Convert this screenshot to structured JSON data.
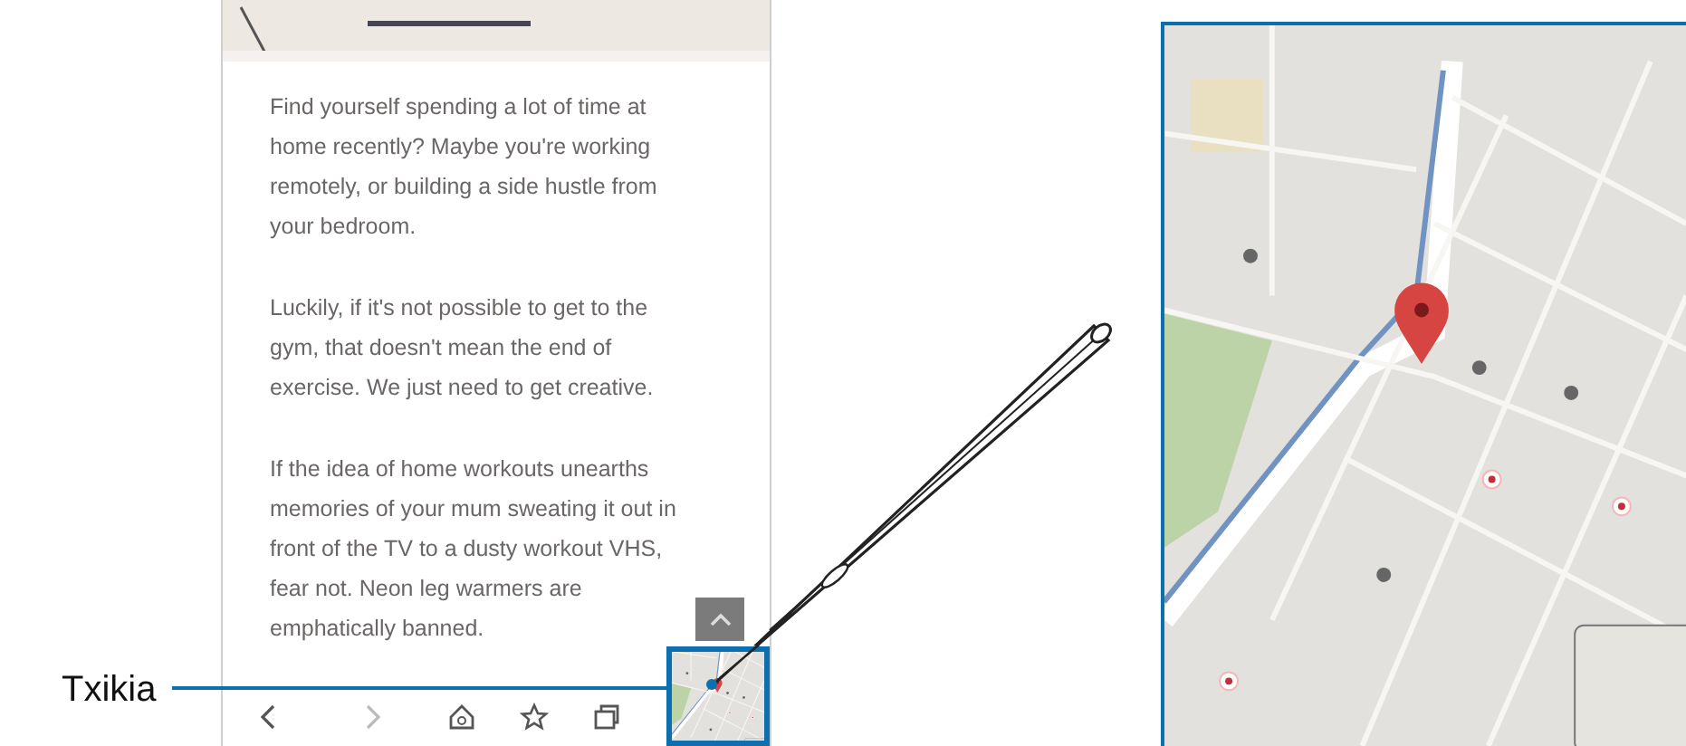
{
  "callout": {
    "label": "Txikia"
  },
  "browser": {
    "paragraphs": [
      "Find yourself spending a lot of time at home recently? Maybe you're working remotely, or building a side hustle from your bedroom.",
      "Luckily, if it's not possible to get to the gym, that doesn't mean the end of exercise. We just need to get creative.",
      "If the idea of home workouts unearths memories of your mum sweating it out in front of the TV to a dusty workout VHS, fear not. Neon leg warmers are emphatically banned."
    ]
  }
}
